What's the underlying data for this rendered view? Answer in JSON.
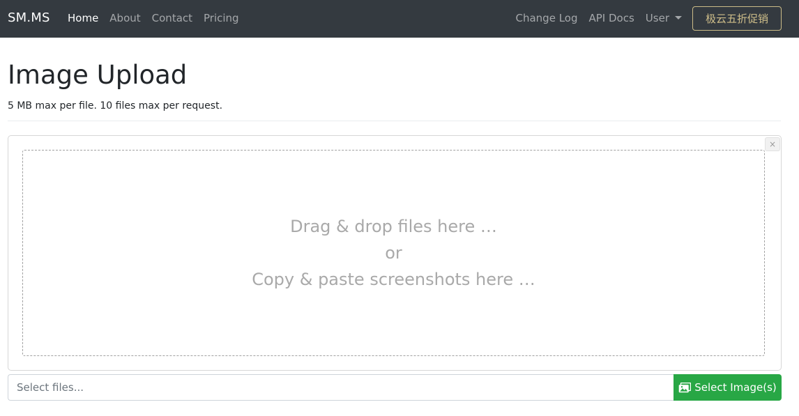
{
  "navbar": {
    "brand": "SM.MS",
    "left_links": [
      "Home",
      "About",
      "Contact",
      "Pricing"
    ],
    "right_links": [
      "Change Log",
      "API Docs"
    ],
    "user_menu": "User",
    "promo_button": "极云五折促销"
  },
  "main": {
    "title": "Image Upload",
    "subtitle": "5 MB max per file. 10 files max per request.",
    "close_glyph": "×",
    "dropzone_lines": [
      "Drag & drop files here …",
      "or",
      "Copy & paste screenshots here …"
    ],
    "file_input_placeholder": "Select files...",
    "select_button_label": "Select Image(s)"
  },
  "colors": {
    "navbar_bg": "#343a40",
    "select_button_bg": "#28a745",
    "promo_border": "#ffe8a1"
  },
  "icons": {
    "select_button_icon": "images-icon"
  }
}
